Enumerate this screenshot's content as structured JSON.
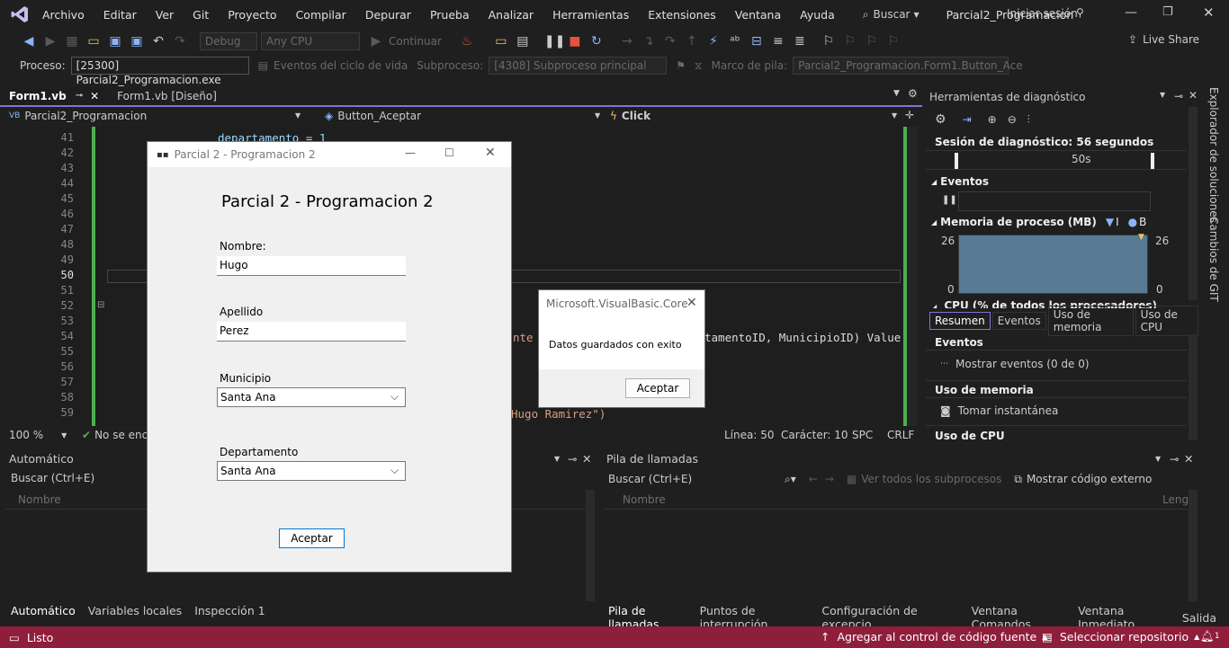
{
  "menu": {
    "items": [
      "Archivo",
      "Editar",
      "Ver",
      "Git",
      "Proyecto",
      "Compilar",
      "Depurar",
      "Prueba",
      "Analizar",
      "Herramientas",
      "Extensiones",
      "Ventana",
      "Ayuda"
    ],
    "search_label": "Buscar",
    "solution_title": "Parcial2_Programacion",
    "signin_label": "Iniciar sesión"
  },
  "toolbar": {
    "config_value": "Debug",
    "platform_value": "Any CPU",
    "continue_label": "Continuar",
    "liveshare_label": "Live Share"
  },
  "processbar": {
    "process_label": "Proceso:",
    "process_value": "[25300] Parcial2_Programacion.exe",
    "lifecycle_label": "Eventos del ciclo de vida",
    "thread_label": "Subproceso:",
    "thread_value": "[4308] Subproceso principal",
    "stackframe_label": "Marco de pila:",
    "stackframe_value": "Parcial2_Programacion.Form1.Button_Ace"
  },
  "tabs": [
    {
      "label": "Form1.vb",
      "active": true
    },
    {
      "label": "Form1.vb [Diseño]",
      "active": false
    }
  ],
  "navbar": {
    "project": "Parcial2_Programacion",
    "member": "Button_Aceptar",
    "event": "Click"
  },
  "editor": {
    "line_numbers": [
      "41",
      "42",
      "43",
      "44",
      "45",
      "46",
      "47",
      "48",
      "49",
      "50",
      "51",
      "52",
      "53",
      "54",
      "55",
      "56",
      "57",
      "58",
      "59"
    ],
    "current_line": "50",
    "code_line_41": "departamento = 1",
    "code_fragment_54_a": "nte",
    "code_fragment_54_b": "tamentoID, MunicipioID) Value",
    "code_fragment_59": "Hugo Ramirez\")"
  },
  "editor_status": {
    "zoom": "100 %",
    "issues": "No se enco",
    "line": "Línea: 50",
    "char": "Carácter: 10",
    "spc": "SPC",
    "crlf": "CRLF"
  },
  "diagnostics": {
    "title": "Herramientas de diagnóstico",
    "session": "Sesión de diagnóstico: 56 segundos",
    "timeline_label": "50s",
    "events_header": "Eventos",
    "memory_header": "Memoria de proceso (MB)",
    "memory_legend_a": "I",
    "memory_legend_b": "B",
    "mem_max_left": "26",
    "mem_min_left": "0",
    "mem_max_right": "26",
    "mem_min_right": "0",
    "cpu_header": "CPU (% de todos los procesadores)",
    "tabs": [
      "Resumen",
      "Eventos",
      "Uso de memoria",
      "Uso de CPU"
    ],
    "section_events": "Eventos",
    "show_events": "Mostrar eventos (0 de 0)",
    "section_memory": "Uso de memoria",
    "snapshot": "Tomar instantánea",
    "section_cpu": "Uso de CPU",
    "side_tabs": [
      "Explorador de soluciones",
      "Cambios de GIT"
    ]
  },
  "autos_panel": {
    "title": "Automático",
    "search_placeholder": "Buscar (Ctrl+E)",
    "column_name": "Nombre",
    "bottom_tabs": [
      "Automático",
      "Variables locales",
      "Inspección 1"
    ]
  },
  "callstack_panel": {
    "title": "Pila de llamadas",
    "search_placeholder": "Buscar (Ctrl+E)",
    "view_threads": "Ver todos los subprocesos",
    "show_external": "Mostrar código externo",
    "column_name": "Nombre",
    "column_lang": "Leng",
    "bottom_tabs": [
      "Pila de llamadas",
      "Puntos de interrupción",
      "Configuración de excepcio...",
      "Ventana Comandos",
      "Ventana Inmediato",
      "Salida"
    ]
  },
  "statusbar": {
    "ready": "Listo",
    "add_source": "Agregar al control de código fuente",
    "select_repo": "Seleccionar repositorio",
    "notifications": "1"
  },
  "winform": {
    "window_title": "Parcial 2 - Programacion 2",
    "heading": "Parcial 2 - Programacion 2",
    "nombre_label": "Nombre:",
    "nombre_value": "Hugo",
    "apellido_label": "Apellido",
    "apellido_value": "Perez",
    "municipio_label": "Municipio",
    "municipio_value": "Santa Ana",
    "departamento_label": "Departamento",
    "departamento_value": "Santa Ana",
    "accept_button": "Aceptar"
  },
  "messagebox": {
    "title": "Microsoft.VisualBasic.Core",
    "message": "Datos guardados con exito",
    "ok_button": "Aceptar"
  }
}
